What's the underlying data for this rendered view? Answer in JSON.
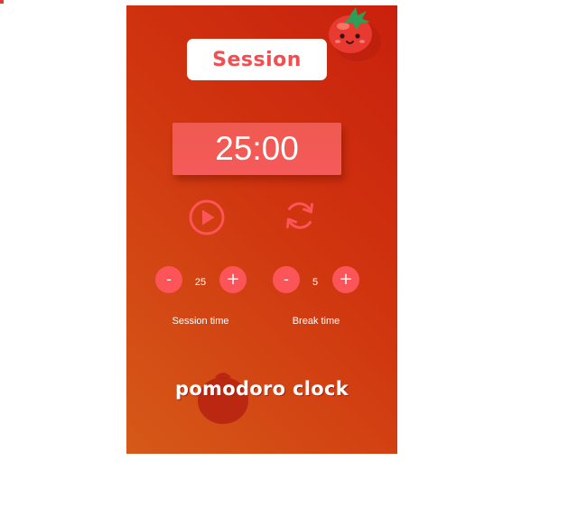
{
  "mode_label": "Session",
  "timer": "25:00",
  "controls": {
    "play_icon": "play-circle-icon",
    "reset_icon": "refresh-icon"
  },
  "session": {
    "decrement_label": "-",
    "increment_label": "+",
    "value": "25",
    "caption": "Session time"
  },
  "break": {
    "decrement_label": "-",
    "increment_label": "+",
    "value": "5",
    "caption": "Break time"
  },
  "footer_title": "pomodoro clock",
  "colors": {
    "background_top": "#c9200d",
    "background_bottom": "#d55a18",
    "accent": "#fb5459",
    "text": "#ffffff"
  }
}
